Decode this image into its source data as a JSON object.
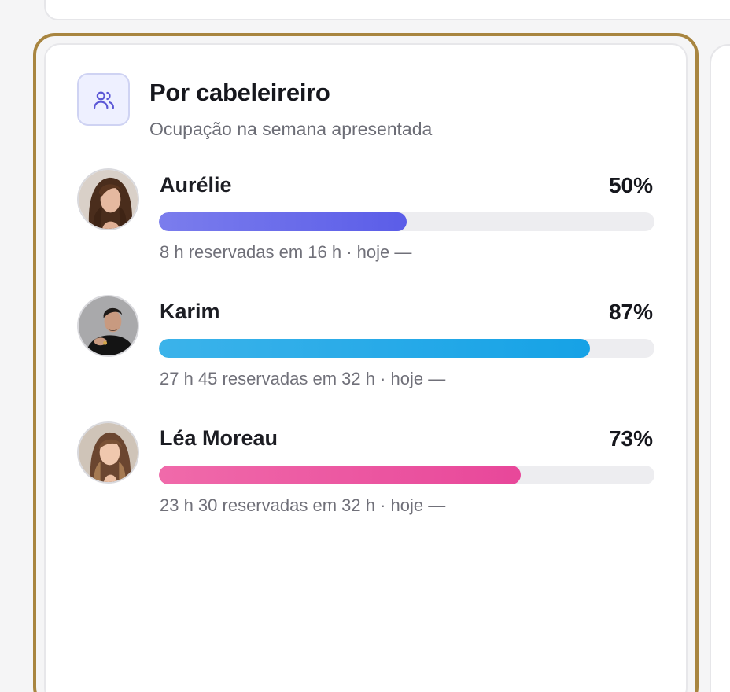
{
  "card": {
    "title": "Por cabeleireiro",
    "subtitle": "Ocupação na semana apresentada",
    "icon": "users-icon"
  },
  "colors": {
    "focus_ring": "#a88540",
    "track": "#ededf0",
    "icon_bg": "#eef0ff",
    "icon_stroke": "#5b57d6"
  },
  "stylists": [
    {
      "name": "Aurélie",
      "percent_label": "50%",
      "occupancy": 0.5,
      "meta": "8 h reservadas em 16 h · hoje —",
      "bar_from": "#7b7ded",
      "bar_to": "#5b5de8",
      "avatar": "avatar-aurelie"
    },
    {
      "name": "Karim",
      "percent_label": "87%",
      "occupancy": 0.87,
      "meta": "27 h 45 reservadas em 32 h · hoje —",
      "bar_from": "#3bb3ea",
      "bar_to": "#16a2e6",
      "avatar": "avatar-karim"
    },
    {
      "name": "Léa Moreau",
      "percent_label": "73%",
      "occupancy": 0.73,
      "meta": "23 h 30 reservadas em 32 h · hoje —",
      "bar_from": "#f06aaa",
      "bar_to": "#e8479a",
      "avatar": "avatar-lea"
    }
  ]
}
